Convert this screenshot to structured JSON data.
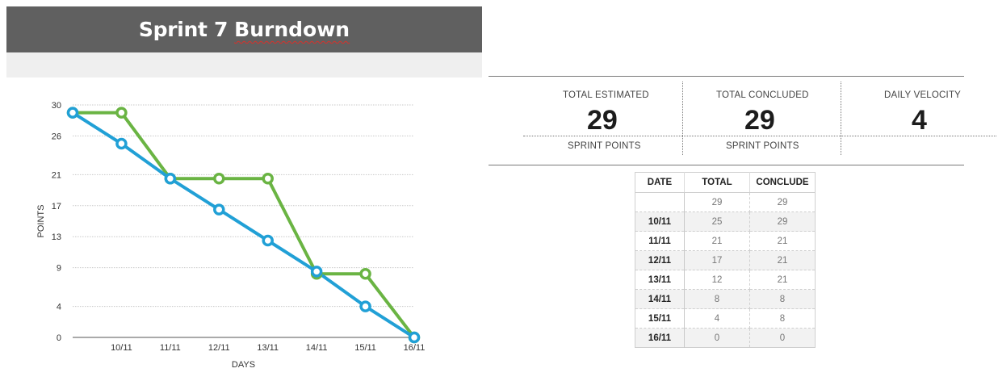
{
  "header": {
    "title_part1": "Sprint 7",
    "title_part2": "Burndown"
  },
  "stats": [
    {
      "label": "TOTAL ESTIMATED",
      "value": "29",
      "sub": "SPRINT POINTS"
    },
    {
      "label": "TOTAL CONCLUDED",
      "value": "29",
      "sub": "SPRINT POINTS"
    },
    {
      "label": "DAILY VELOCITY",
      "value": "4",
      "sub": ""
    }
  ],
  "table": {
    "headers": [
      "DATE",
      "TOTAL",
      "CONCLUDE"
    ],
    "rows": [
      [
        "",
        "29",
        "29"
      ],
      [
        "10/11",
        "25",
        "29"
      ],
      [
        "11/11",
        "21",
        "21"
      ],
      [
        "12/11",
        "17",
        "21"
      ],
      [
        "13/11",
        "12",
        "21"
      ],
      [
        "14/11",
        "8",
        "8"
      ],
      [
        "15/11",
        "4",
        "8"
      ],
      [
        "16/11",
        "0",
        "0"
      ]
    ]
  },
  "chart_data": {
    "type": "line",
    "x": [
      "",
      "10/11",
      "11/11",
      "12/11",
      "13/11",
      "14/11",
      "15/11",
      "16/11"
    ],
    "series": [
      {
        "values": [
          29,
          29,
          20.5,
          20.5,
          20.5,
          8.2,
          8.2,
          0
        ],
        "color": "#6ab443"
      },
      {
        "values": [
          29,
          25,
          20.5,
          16.5,
          12.5,
          8.5,
          4,
          0
        ],
        "color": "#21a0d6"
      }
    ],
    "yticks": [
      0,
      4,
      9,
      13,
      17,
      21,
      26,
      30
    ],
    "ylim": [
      0,
      30
    ],
    "xlabel": "DAYS",
    "ylabel": "POINTS",
    "grid": true
  }
}
